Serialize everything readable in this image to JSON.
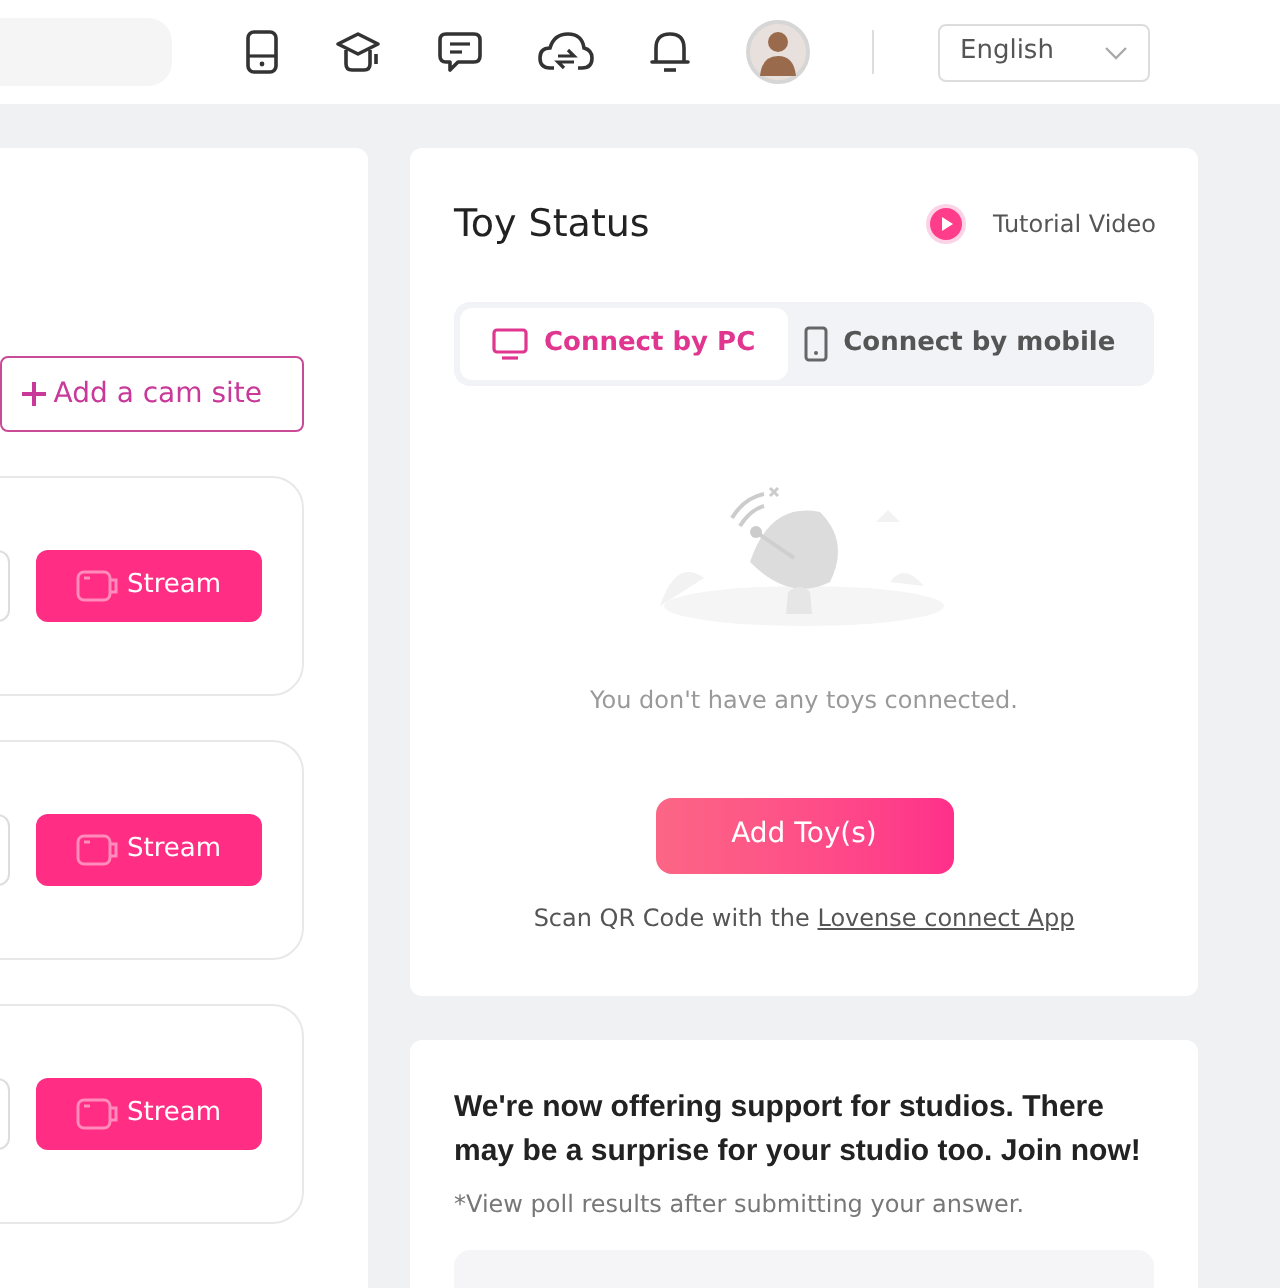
{
  "header": {
    "language": "English"
  },
  "cam_sites": {
    "add_button": "Add a cam site",
    "sites": [
      {
        "stream_button": "Stream"
      },
      {
        "stream_button": "Stream"
      },
      {
        "stream_button": "Stream"
      }
    ]
  },
  "toy_status": {
    "title": "Toy Status",
    "tutorial_link": "Tutorial Video",
    "tabs": [
      {
        "kind": "pc",
        "label": "Connect by PC",
        "selected": true
      },
      {
        "kind": "mobile",
        "label": "Connect by mobile",
        "selected": false
      }
    ],
    "empty_message": "You don't have any toys connected.",
    "add_button": "Add Toy(s)",
    "scan_text": "Scan QR Code with the",
    "app_link": "Lovense connect App"
  },
  "promo": {
    "heading": "We're now offering support for studios. There may be a surprise for your studio too. Join now!",
    "note": "*View poll results after submitting your answer."
  }
}
